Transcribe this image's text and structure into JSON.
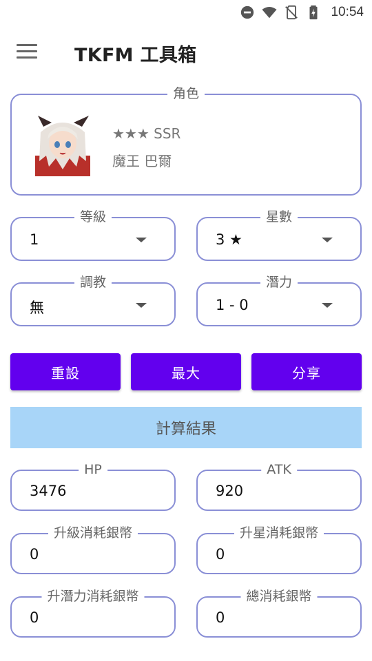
{
  "status_bar": {
    "time": "10:54",
    "icons": [
      "do-not-disturb-icon",
      "wifi-icon",
      "no-sim-icon",
      "battery-charging-icon"
    ]
  },
  "app_bar": {
    "title": "TKFM 工具箱",
    "menu_icon": "hamburger-menu-icon"
  },
  "character": {
    "label": "角色",
    "rarity": "★★★ SSR",
    "name": "魔王 巴爾"
  },
  "selectors": {
    "level": {
      "label": "等級",
      "value": "1"
    },
    "stars": {
      "label": "星數",
      "value": "3 ★"
    },
    "training": {
      "label": "調教",
      "value": "無"
    },
    "potential": {
      "label": "潛力",
      "value": "1 - 0"
    }
  },
  "buttons": {
    "reset": "重設",
    "max": "最大",
    "share": "分享"
  },
  "result": {
    "header": "計算結果",
    "hp": {
      "label": "HP",
      "value": "3476"
    },
    "atk": {
      "label": "ATK",
      "value": "920"
    },
    "level_cost": {
      "label": "升級消耗銀幣",
      "value": "0"
    },
    "star_cost": {
      "label": "升星消耗銀幣",
      "value": "0"
    },
    "potential_cost": {
      "label": "升潛力消耗銀幣",
      "value": "0"
    },
    "total_cost": {
      "label": "總消耗銀幣",
      "value": "0"
    }
  },
  "colors": {
    "primary": "#6200ee",
    "outline": "#8a8fd6",
    "result_header_bg": "#a8d5f8"
  }
}
